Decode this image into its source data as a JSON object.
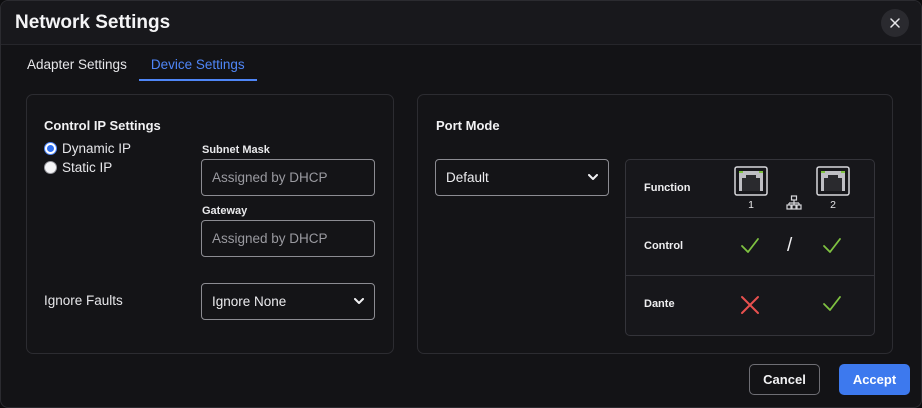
{
  "dialog": {
    "title": "Network Settings"
  },
  "tabs": [
    {
      "label": "Adapter Settings",
      "active": false
    },
    {
      "label": "Device Settings",
      "active": true
    }
  ],
  "control_ip": {
    "title": "Control IP Settings",
    "options": [
      {
        "label": "Dynamic IP",
        "checked": true
      },
      {
        "label": "Static IP",
        "checked": false
      }
    ],
    "subnet_mask": {
      "label": "Subnet Mask",
      "placeholder": "Assigned by DHCP"
    },
    "gateway": {
      "label": "Gateway",
      "placeholder": "Assigned by DHCP"
    },
    "ignore_faults": {
      "label": "Ignore Faults",
      "value": "Ignore None"
    }
  },
  "port_mode": {
    "title": "Port Mode",
    "value": "Default",
    "table": {
      "header_label": "Function",
      "ports": [
        "1",
        "2"
      ],
      "rows": [
        {
          "label": "Control",
          "port1": "check",
          "separator": "/",
          "port2": "check"
        },
        {
          "label": "Dante",
          "port1": "cross",
          "port2": "check"
        }
      ]
    }
  },
  "colors": {
    "accent": "#3d79ee",
    "check": "#7fc241",
    "cross": "#e8504f"
  },
  "footer": {
    "cancel_label": "Cancel",
    "accept_label": "Accept"
  }
}
